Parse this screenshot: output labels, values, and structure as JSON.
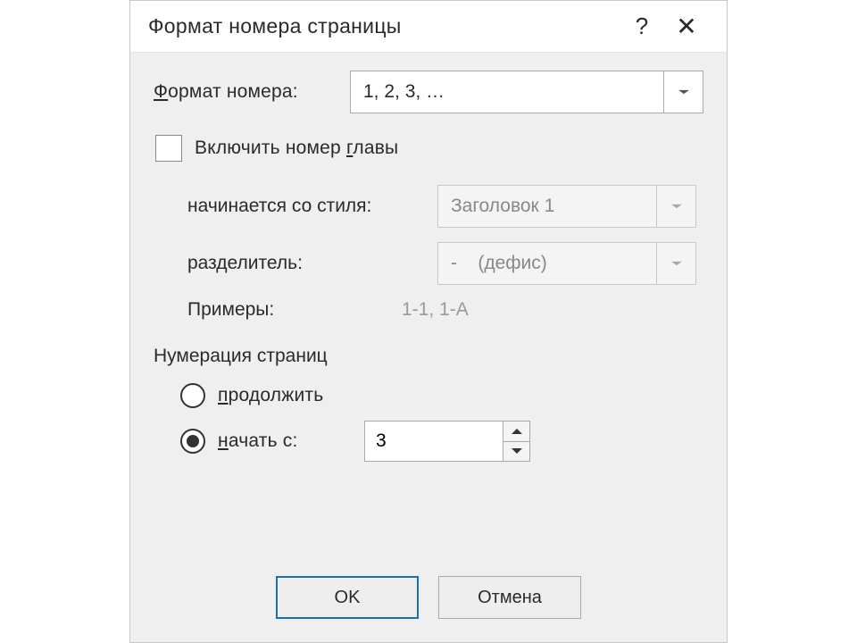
{
  "titlebar": {
    "title": "Формат номера страницы",
    "help": "?",
    "close": "✕"
  },
  "format": {
    "label_pre": "Ф",
    "label_rest": "ормат номера:",
    "value": "1, 2, 3, …"
  },
  "chapter": {
    "checkbox_label_pre": "Включить номер ",
    "checkbox_label_u": "г",
    "checkbox_label_post": "лавы",
    "style_label": "начинается со стиля:",
    "style_value": "Заголовок 1",
    "sep_label": "разделитель:",
    "sep_value": "-    (дефис)",
    "example_label": "Примеры:",
    "example_value": "1-1, 1-A"
  },
  "numbering": {
    "section_label": "Нумерация страниц",
    "continue_u": "п",
    "continue_rest": "родолжить",
    "start_u": "н",
    "start_rest": "ачать с:",
    "start_value": "3"
  },
  "buttons": {
    "ok": "OK",
    "cancel": "Отмена"
  }
}
